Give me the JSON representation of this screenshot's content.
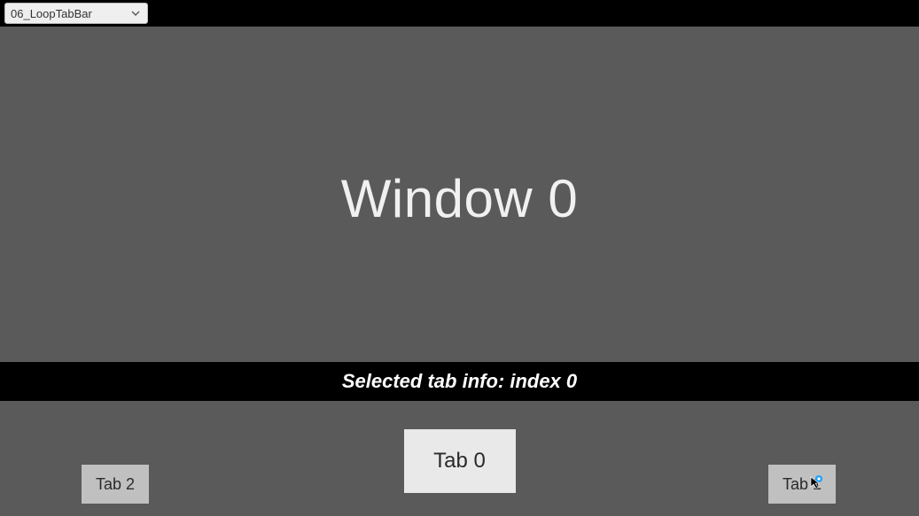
{
  "topbar": {
    "dropdown_value": "06_LoopTabBar"
  },
  "window": {
    "title": "Window 0"
  },
  "status": {
    "text": "Selected tab info: index 0"
  },
  "tabs": {
    "left": {
      "label": "Tab 2"
    },
    "center": {
      "label": "Tab 0"
    },
    "right": {
      "label": "Tab 1"
    }
  }
}
